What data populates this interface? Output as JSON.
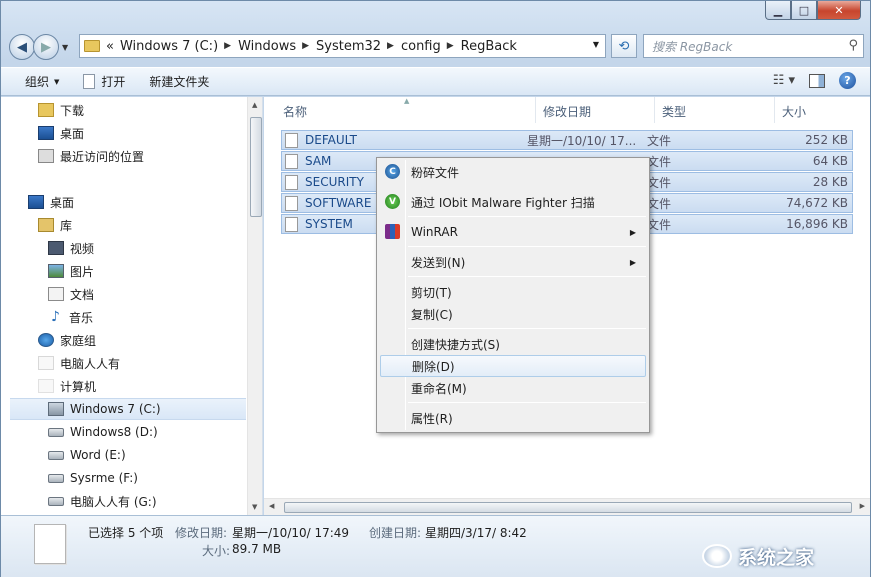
{
  "caption": {
    "minimize": "▁",
    "maximize": "□",
    "close": "✕"
  },
  "address": {
    "prefix": "«",
    "crumbs": [
      "Windows 7  (C:)",
      "Windows",
      "System32",
      "config",
      "RegBack"
    ]
  },
  "search": {
    "placeholder": "搜索 RegBack"
  },
  "toolbar": {
    "organize": "组织",
    "open": "打开",
    "new_folder": "新建文件夹"
  },
  "navigation": [
    {
      "label": "下载",
      "icon": "download-folder-icon"
    },
    {
      "label": "桌面",
      "icon": "desktop-icon"
    },
    {
      "label": "最近访问的位置",
      "icon": "recent-places-icon"
    },
    {
      "label": "桌面",
      "icon": "desktop-icon"
    },
    {
      "label": "库",
      "icon": "libraries-icon"
    },
    {
      "label": "视频",
      "icon": "video-icon"
    },
    {
      "label": "图片",
      "icon": "pictures-icon"
    },
    {
      "label": "文档",
      "icon": "documents-icon"
    },
    {
      "label": "音乐",
      "icon": "music-icon"
    },
    {
      "label": "家庭组",
      "icon": "homegroup-icon"
    },
    {
      "label": "电脑人人有",
      "icon": "user-folder-icon"
    },
    {
      "label": "计算机",
      "icon": "computer-icon"
    },
    {
      "label": "Windows 7  (C:)",
      "icon": "system-drive-icon",
      "selected": true
    },
    {
      "label": "Windows8 (D:)",
      "icon": "drive-icon"
    },
    {
      "label": "Word (E:)",
      "icon": "drive-icon"
    },
    {
      "label": "Sysrme (F:)",
      "icon": "drive-icon"
    },
    {
      "label": "电脑人人有 (G:)",
      "icon": "drive-icon"
    }
  ],
  "columns": {
    "name": "名称",
    "date": "修改日期",
    "type": "类型",
    "size": "大小"
  },
  "files": [
    {
      "name": "DEFAULT",
      "date": "星期一/10/10/ 17...",
      "type": "文件",
      "size": "252 KB"
    },
    {
      "name": "SAM",
      "date": "",
      "type": "文件",
      "size": "64 KB"
    },
    {
      "name": "SECURITY",
      "date": "",
      "type": "文件",
      "size": "28 KB"
    },
    {
      "name": "SOFTWARE",
      "date": "",
      "type": "文件",
      "size": "74,672 KB"
    },
    {
      "name": "SYSTEM",
      "date": "",
      "type": "文件",
      "size": "16,896 KB"
    }
  ],
  "context_menu": {
    "shred": "粉碎文件",
    "iobit": "通过 IObit Malware Fighter 扫描",
    "winrar": "WinRAR",
    "send_to": "发送到(N)",
    "cut": "剪切(T)",
    "copy": "复制(C)",
    "shortcut": "创建快捷方式(S)",
    "delete": "删除(D)",
    "rename": "重命名(M)",
    "properties": "属性(R)",
    "submenu_arrow": "▶"
  },
  "status": {
    "selected": "已选择 5 个项",
    "modified_label": "修改日期:",
    "modified_value": "星期一/10/10/ 17:49",
    "created_label": "创建日期:",
    "created_value": "星期四/3/17/ 8:42",
    "size_label": "大小:",
    "size_value": "89.7 MB"
  },
  "watermark": {
    "text": "系统之家"
  }
}
